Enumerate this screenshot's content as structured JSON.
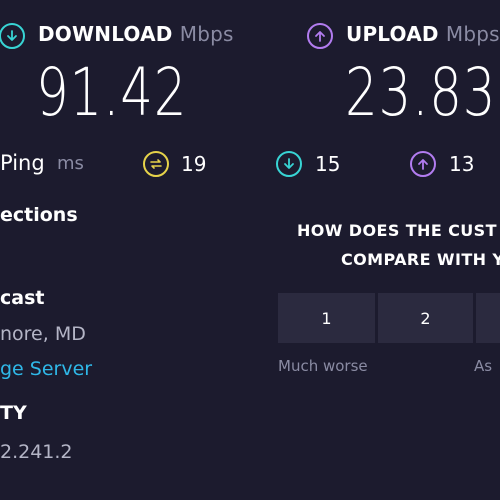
{
  "download": {
    "title": "DOWNLOAD",
    "unit": "Mbps",
    "value": "91.42",
    "icon": "arrow-down-circle-icon",
    "color": "#38d4d4"
  },
  "upload": {
    "title": "UPLOAD",
    "unit": "Mbps",
    "value": "23.83",
    "icon": "arrow-up-circle-icon",
    "color": "#b27cf0"
  },
  "ping": {
    "label": "Ping",
    "unit": "ms",
    "idle": "19",
    "download": "15",
    "upload": "13",
    "idle_color": "#e6d34a"
  },
  "connections": {
    "label": "ections"
  },
  "isp": {
    "label": "cast",
    "location": "nore, MD",
    "change_server": "ge Server"
  },
  "ip": {
    "label": "TY",
    "value": "2.241.2"
  },
  "survey": {
    "question_line1": "HOW DOES THE CUST",
    "question_line2": "COMPARE WITH Y",
    "options": [
      "1",
      "2",
      ""
    ],
    "low_label": "Much worse",
    "mid_label": "As"
  },
  "colors": {
    "background": "#1c1b2e",
    "button": "#2b2a3f",
    "link": "#2fb8e8",
    "muted": "#8a8ba3"
  }
}
